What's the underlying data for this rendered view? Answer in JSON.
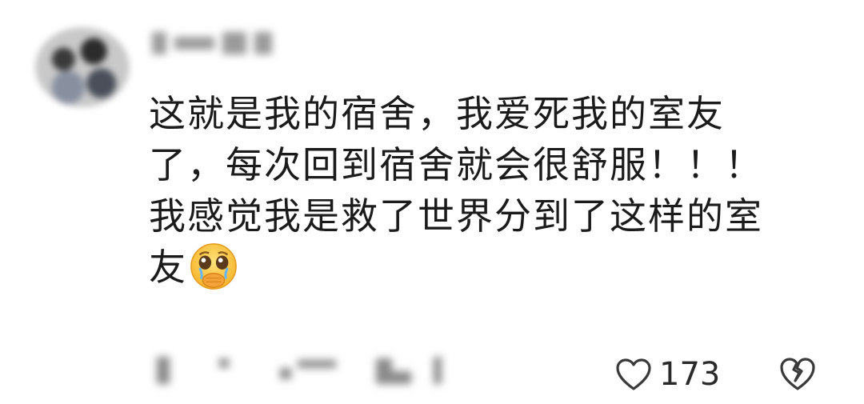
{
  "comment": {
    "lines": [
      "这就是我的宿舍，我爱死我的室友",
      "了，每次回到宿舍就会很舒服！！！",
      "我感觉我是救了世界分到了这样的室",
      "友"
    ],
    "emoji": "pleading-face-holding-back-tears-emoji"
  },
  "actions": {
    "like_count": "173",
    "like_icon": "heart-outline-icon",
    "dislike_icon": "broken-heart-icon"
  }
}
